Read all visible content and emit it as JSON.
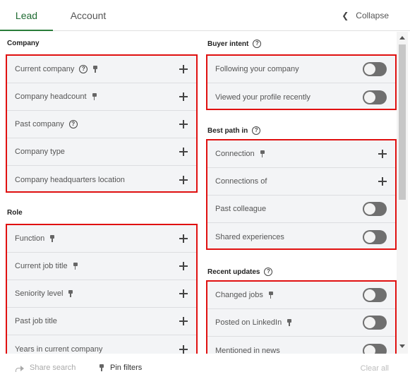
{
  "tabs": {
    "lead": "Lead",
    "account": "Account"
  },
  "collapse_label": "Collapse",
  "left": {
    "company": {
      "title": "Company",
      "items": [
        {
          "label": "Current company",
          "help": true,
          "pin": true,
          "control": "plus"
        },
        {
          "label": "Company headcount",
          "help": false,
          "pin": true,
          "control": "plus"
        },
        {
          "label": "Past company",
          "help": true,
          "pin": false,
          "control": "plus"
        },
        {
          "label": "Company type",
          "help": false,
          "pin": false,
          "control": "plus"
        },
        {
          "label": "Company headquarters location",
          "help": false,
          "pin": false,
          "control": "plus"
        }
      ]
    },
    "role": {
      "title": "Role",
      "items": [
        {
          "label": "Function",
          "pin": true,
          "control": "plus"
        },
        {
          "label": "Current job title",
          "pin": true,
          "control": "plus"
        },
        {
          "label": "Seniority level",
          "pin": true,
          "control": "plus"
        },
        {
          "label": "Past job title",
          "pin": false,
          "control": "plus"
        },
        {
          "label": "Years in current company",
          "pin": false,
          "control": "plus"
        }
      ]
    }
  },
  "right": {
    "buyer_intent": {
      "title": "Buyer intent",
      "items": [
        {
          "label": "Following your company",
          "control": "toggle",
          "on": false
        },
        {
          "label": "Viewed your profile recently",
          "control": "toggle",
          "on": false
        }
      ]
    },
    "best_path": {
      "title": "Best path in",
      "items": [
        {
          "label": "Connection",
          "pin": true,
          "control": "plus"
        },
        {
          "label": "Connections of",
          "pin": false,
          "control": "plus"
        },
        {
          "label": "Past colleague",
          "pin": false,
          "control": "toggle",
          "on": false
        },
        {
          "label": "Shared experiences",
          "pin": false,
          "control": "toggle",
          "on": false
        }
      ]
    },
    "recent_updates": {
      "title": "Recent updates",
      "items": [
        {
          "label": "Changed jobs",
          "pin": true,
          "control": "toggle",
          "on": false
        },
        {
          "label": "Posted on LinkedIn",
          "pin": true,
          "control": "toggle",
          "on": false
        },
        {
          "label": "Mentioned in news",
          "pin": false,
          "control": "toggle",
          "on": false
        }
      ]
    }
  },
  "footer": {
    "share_search": "Share search",
    "pin_filters": "Pin filters",
    "clear_all": "Clear all"
  },
  "colors": {
    "accent_green": "#2a7d3a",
    "highlight_red": "#e01010",
    "toggle_off": "#6f6f6f"
  }
}
